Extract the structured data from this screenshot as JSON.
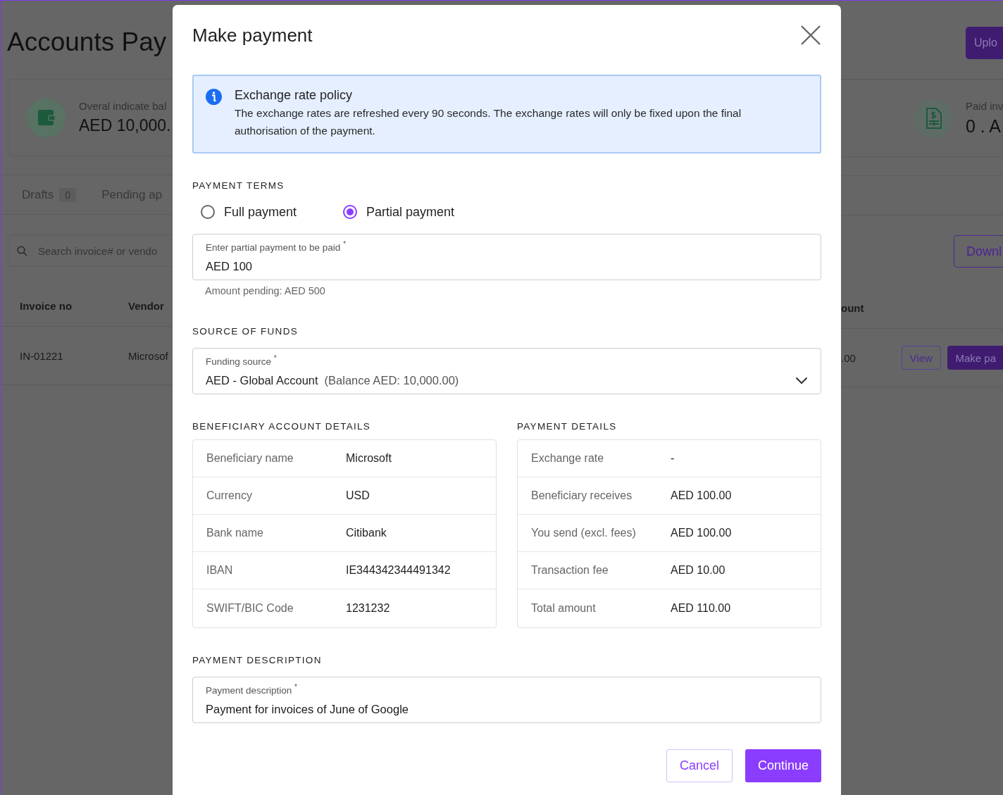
{
  "background": {
    "page_title": "Accounts Pay",
    "upload_button": "Uplo",
    "summary_cards": [
      {
        "label": "Overal indicate bal",
        "value": "AED 10,000."
      },
      {
        "label": "Paid inv",
        "value": "0 . A"
      }
    ],
    "tabs": [
      {
        "label": "Drafts",
        "count": "0"
      },
      {
        "label": "Pending ap"
      }
    ],
    "search": {
      "placeholder": "Search invoice# or vendo"
    },
    "download_button": "Downl",
    "table": {
      "columns": [
        "Invoice no",
        "Vendor",
        "ount"
      ],
      "rows": [
        {
          "cells": [
            "IN-01221",
            "Microsof",
            ".00"
          ],
          "actions": [
            "View",
            "Make pa"
          ]
        }
      ]
    }
  },
  "modal": {
    "title": "Make payment",
    "notice": {
      "title": "Exchange rate policy",
      "text": "The exchange rates are refreshed every 90 seconds. The exchange rates will only be fixed upon the final authorisation of the payment."
    },
    "payment_terms": {
      "heading": "PAYMENT TERMS",
      "options": [
        {
          "label": "Full payment",
          "selected": false
        },
        {
          "label": "Partial payment",
          "selected": true
        }
      ],
      "amount_field": {
        "label": "Enter partial payment to be paid",
        "required_mark": "*",
        "value": "AED 100"
      },
      "helper": "Amount pending: AED 500"
    },
    "source_of_funds": {
      "heading": "SOURCE OF FUNDS",
      "field": {
        "label": "Funding source",
        "required_mark": "*",
        "value": "AED - Global Account",
        "note": "(Balance AED: 10,000.00)"
      }
    },
    "beneficiary": {
      "heading": "BENEFICIARY ACCOUNT DETAILS",
      "rows": [
        {
          "label": "Beneficiary name",
          "value": "Microsoft"
        },
        {
          "label": "Currency",
          "value": "USD"
        },
        {
          "label": "Bank name",
          "value": "Citibank"
        },
        {
          "label": "IBAN",
          "value": "IE344342344491342"
        },
        {
          "label": "SWIFT/BIC Code",
          "value": "1231232"
        }
      ]
    },
    "payment_details": {
      "heading": "PAYMENT DETAILS",
      "rows": [
        {
          "label": "Exchange rate",
          "value": "-"
        },
        {
          "label": "Beneficiary receives",
          "value": "AED 100.00"
        },
        {
          "label": "You send (excl. fees)",
          "value": "AED 100.00"
        },
        {
          "label": "Transaction fee",
          "value": "AED 10.00"
        },
        {
          "label": "Total amount",
          "value": "AED 110.00"
        }
      ]
    },
    "description": {
      "heading": "PAYMENT DESCRIPTION",
      "field": {
        "label": "Payment description",
        "required_mark": "*",
        "value": "Payment for invoices of June of Google"
      }
    },
    "buttons": [
      {
        "label": "Cancel",
        "kind": "secondary"
      },
      {
        "label": "Continue",
        "kind": "primary"
      }
    ]
  }
}
